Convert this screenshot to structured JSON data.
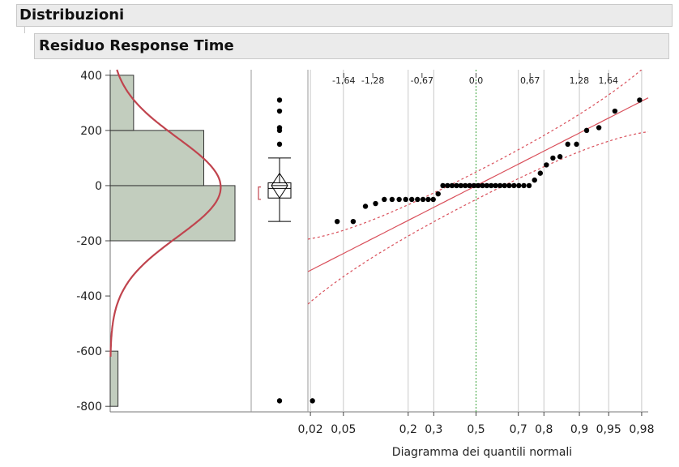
{
  "outline": {
    "title": "Distribuzioni",
    "subtitle": "Residuo Response Time"
  },
  "chart_data": {
    "type": "histogram",
    "y_axis": {
      "ylim": [
        -820,
        420
      ],
      "ticks": [
        400,
        200,
        0,
        -200,
        -400,
        -600,
        -800
      ],
      "tick_labels": [
        "400",
        "200",
        "0",
        "-200",
        "-400",
        "-600",
        "-800"
      ]
    },
    "histogram": {
      "bins": [
        {
          "from": -800,
          "to": -600,
          "count": 1
        },
        {
          "from": -200,
          "to": 0,
          "count": 16
        },
        {
          "from": 0,
          "to": 200,
          "count": 12
        },
        {
          "from": 200,
          "to": 400,
          "count": 3
        }
      ],
      "bar_color": "#c2cdbe",
      "normal_curve_color": "#c0444e"
    },
    "box_plot": {
      "outliers": [
        310,
        270,
        210,
        200,
        150,
        -780
      ],
      "whisker_high": 100,
      "whisker_low": -130,
      "q3": 10,
      "q1": -45,
      "median": -10,
      "mean": 0,
      "mean_diamond": [
        -45,
        45
      ],
      "shortest_half": [
        -50,
        -5
      ]
    },
    "normal_quantile_plot": {
      "xlabel": "Diagramma dei quantili normali",
      "probability_ticks": [
        0.02,
        0.05,
        0.2,
        0.3,
        0.5,
        0.7,
        0.8,
        0.9,
        0.95,
        0.98
      ],
      "probability_labels": [
        "0,02",
        "0,05",
        "0,2",
        "0,3",
        "0,5",
        "0,7",
        "0,8",
        "0,9",
        "0,95",
        "0,98"
      ],
      "z_ticks": [
        -1.64,
        -1.28,
        -0.67,
        0,
        0.67,
        1.28,
        1.64
      ],
      "z_labels": [
        "-1,64",
        "-1,28",
        "-0,67",
        "0,0",
        "0,67",
        "1,28",
        "1,64"
      ],
      "line_color": "#d94f5a",
      "center_line_color": "#3aa33a",
      "points_sorted": [
        -780,
        -130,
        -130,
        -75,
        -65,
        -50,
        -50,
        -50,
        -50,
        -50,
        -50,
        -50,
        -50,
        -50,
        -30,
        0,
        0,
        0,
        0,
        0,
        0,
        0,
        0,
        0,
        0,
        0,
        0,
        0,
        0,
        0,
        0,
        0,
        0,
        0,
        0,
        20,
        45,
        75,
        100,
        105,
        150,
        150,
        200,
        210,
        270,
        310
      ]
    }
  }
}
